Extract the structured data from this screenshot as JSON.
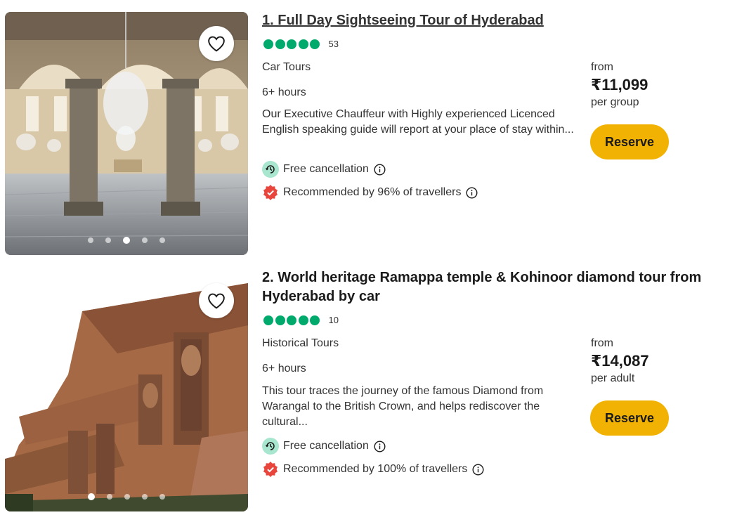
{
  "listings": [
    {
      "title": "1. Full Day Sightseeing Tour of Hyderabad",
      "rating_bubbles": 5,
      "review_count": "53",
      "category": "Car Tours",
      "duration": "6+ hours",
      "description": "Our Executive Chauffeur with Highly experienced Licenced English speaking guide will report at your place of stay within...",
      "free_cancellation": "Free cancellation",
      "recommended": "Recommended by 96% of travellers",
      "price_from": "from",
      "price": "₹11,099",
      "price_unit": "per group",
      "reserve_label": "Reserve",
      "carousel_active_index": 2,
      "carousel_count": 5
    },
    {
      "title": "2. World heritage Ramappa temple & Kohinoor diamond tour from Hyderabad by car",
      "rating_bubbles": 5,
      "review_count": "10",
      "category": "Historical Tours",
      "duration": "6+ hours",
      "description": "This tour traces the journey of the famous Diamond from Warangal to the British Crown, and helps rediscover the cultural...",
      "free_cancellation": "Free cancellation",
      "recommended": "Recommended by 100% of travellers",
      "price_from": "from",
      "price": "₹14,087",
      "price_unit": "per adult",
      "reserve_label": "Reserve",
      "carousel_active_index": 0,
      "carousel_count": 5
    }
  ],
  "colors": {
    "rating_green": "#00aa6c",
    "reserve_yellow": "#f2b203",
    "badge_red": "#e8453c",
    "cancel_green": "#a8e6cf"
  },
  "icons": {
    "favorite": "heart-icon",
    "cancellation": "clock-refresh-icon",
    "recommended": "badge-check-icon",
    "info": "info-icon"
  }
}
